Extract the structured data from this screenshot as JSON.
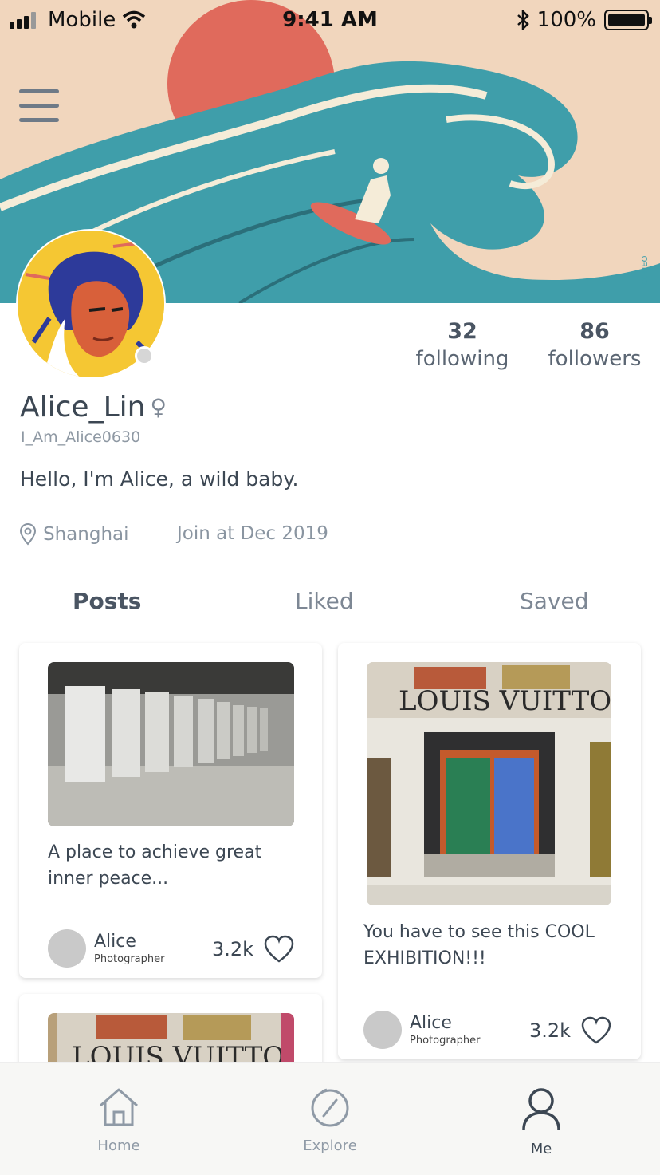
{
  "status_bar": {
    "carrier": "Mobile",
    "time": "9:41 AM",
    "battery": "100%"
  },
  "profile": {
    "following_count": "32",
    "following_label": "following",
    "followers_count": "86",
    "followers_label": "followers",
    "name": "Alice_Lin",
    "gender_symbol": "♀",
    "handle": "I_Am_Alice0630",
    "bio": "Hello, I'm Alice, a wild baby.",
    "location": "Shanghai",
    "joined": "Join at Dec 2019"
  },
  "tabs": [
    {
      "label": "Posts",
      "active": true
    },
    {
      "label": "Liked",
      "active": false
    },
    {
      "label": "Saved",
      "active": false
    }
  ],
  "posts": [
    {
      "caption": "A place to achieve great inner peace...",
      "author": "Alice",
      "role": "Photographer",
      "likes": "3.2k"
    },
    {
      "caption": "You have to see this COOL EXHIBITION!!!",
      "author": "Alice",
      "role": "Photographer",
      "likes": "3.2k"
    }
  ],
  "bottom_nav": [
    {
      "label": "Home",
      "icon": "home-icon"
    },
    {
      "label": "Explore",
      "icon": "compass-icon"
    },
    {
      "label": "Me",
      "icon": "person-icon",
      "active": true
    }
  ],
  "colors": {
    "banner_bg": "#f1d6bd",
    "wave": "#3f9eaa",
    "sun": "#e06a5c",
    "avatar_bg": "#f5c733",
    "text_primary": "#3c4753",
    "text_muted": "#8a95a1"
  }
}
